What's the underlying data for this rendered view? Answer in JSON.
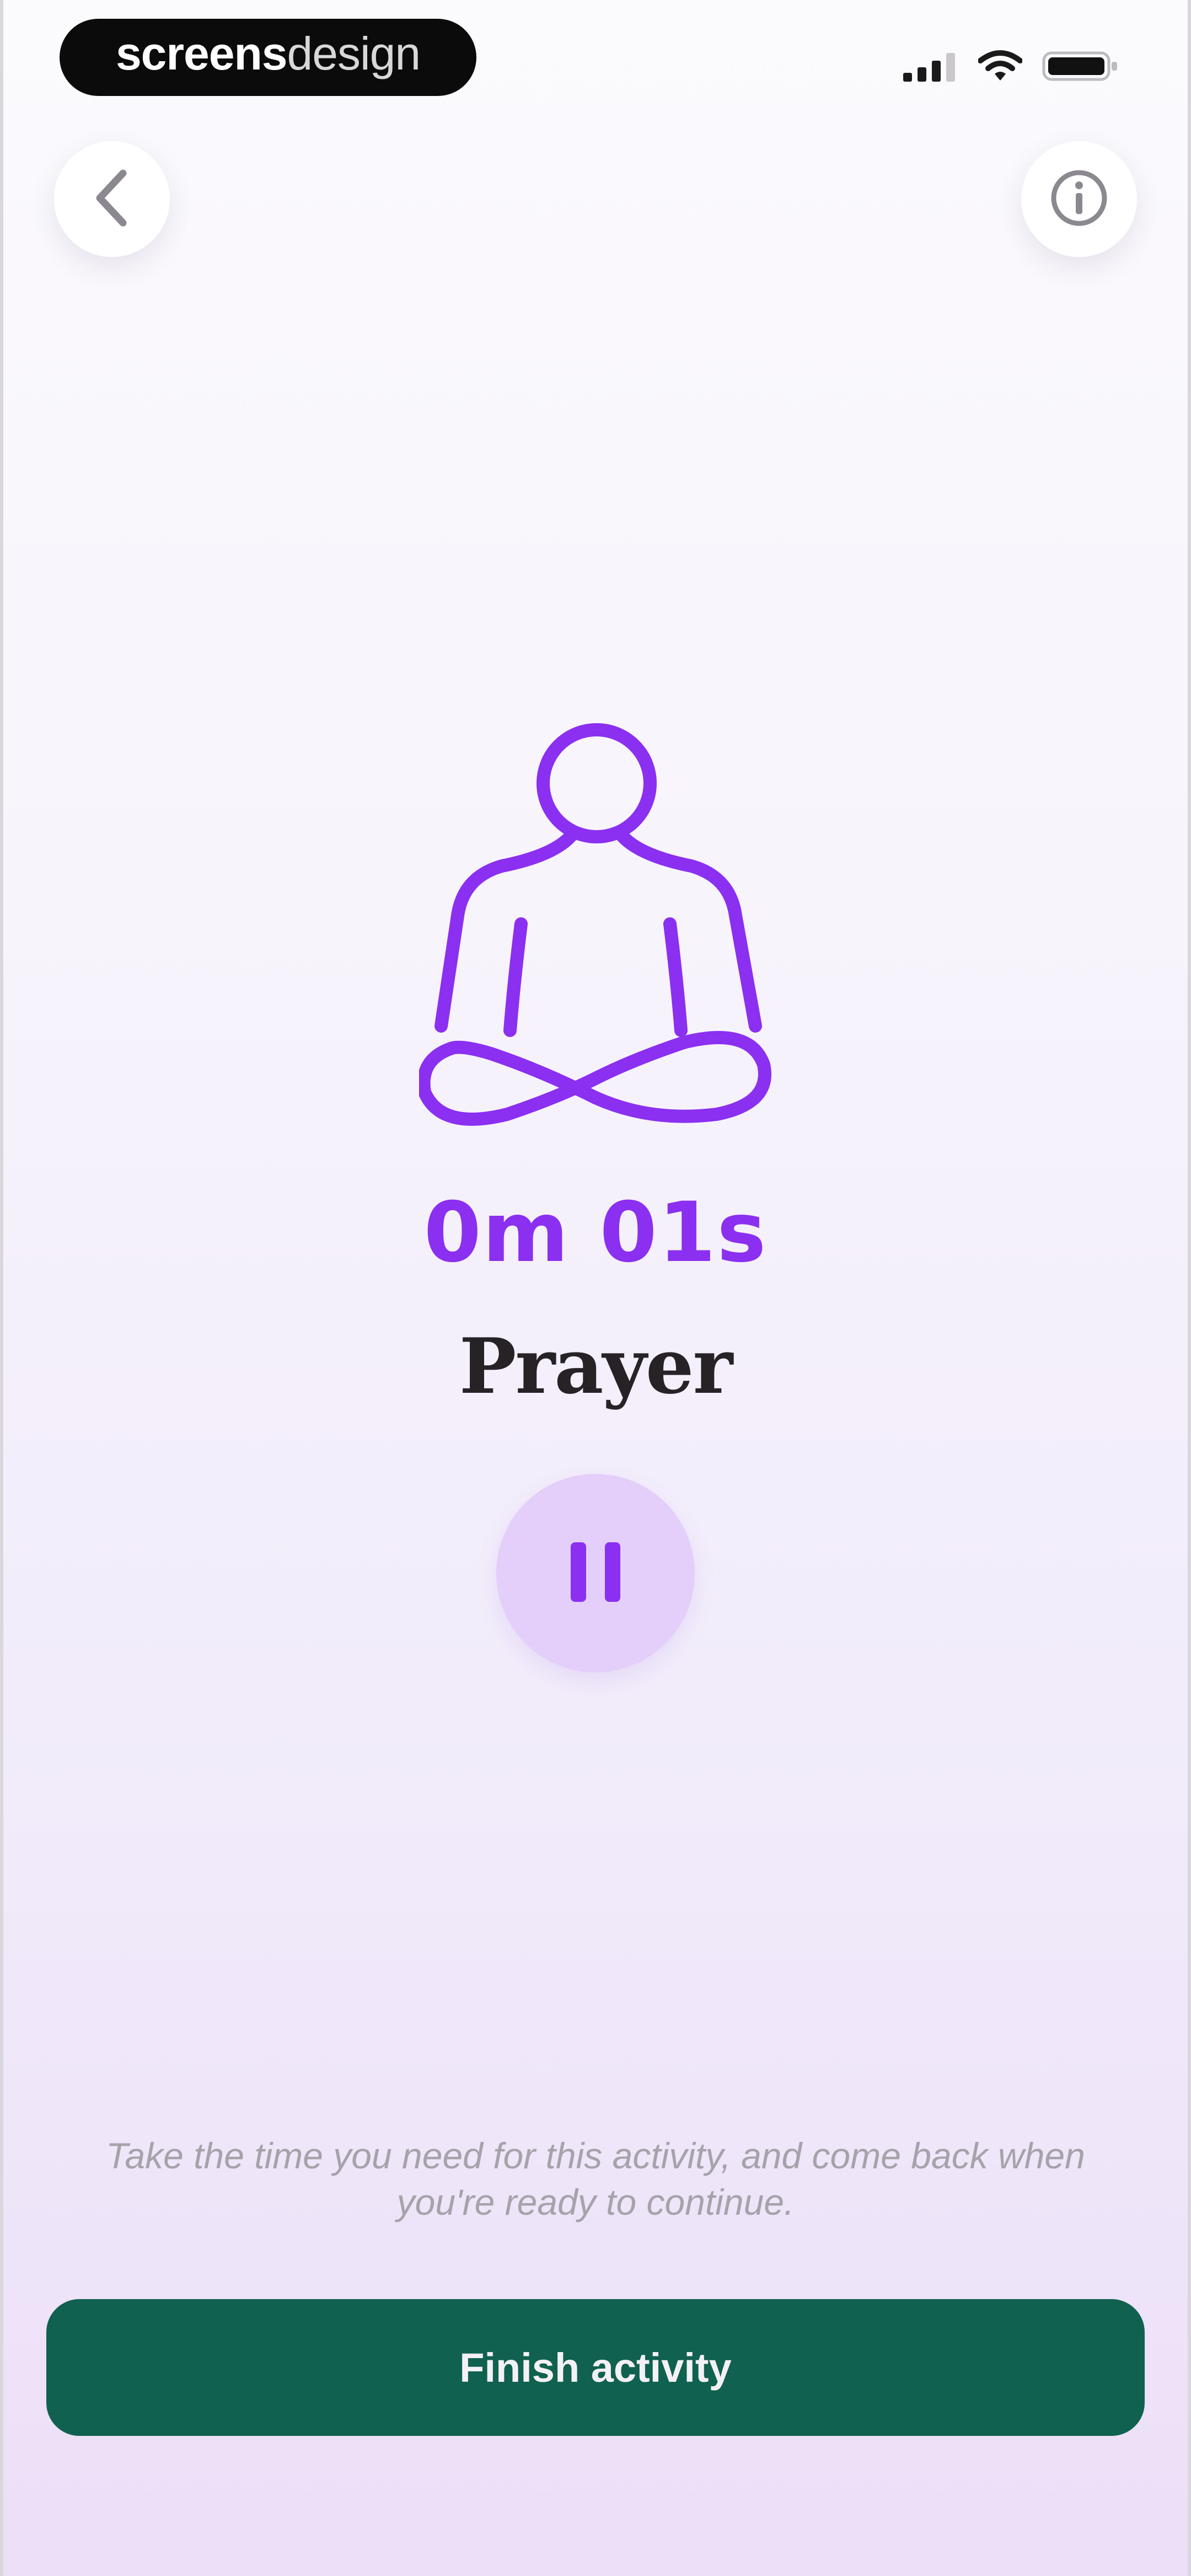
{
  "status_bar": {
    "brand_bold": "screens",
    "brand_light": "design",
    "icons": [
      "signal-icon",
      "wifi-icon",
      "battery-icon"
    ]
  },
  "nav": {
    "back_icon": "chevron-left-icon",
    "info_icon": "info-icon"
  },
  "activity": {
    "icon": "meditation-icon",
    "timer": "0m 01s",
    "title": "Prayer",
    "control_icon": "pause-icon"
  },
  "footer": {
    "hint": "Take the time you need for this activity, and come back when you're ready to continue.",
    "finish_label": "Finish activity"
  },
  "colors": {
    "accent": "#8b2ff0",
    "pause_bg": "#e3cffa",
    "finish_bg": "#10614f"
  }
}
